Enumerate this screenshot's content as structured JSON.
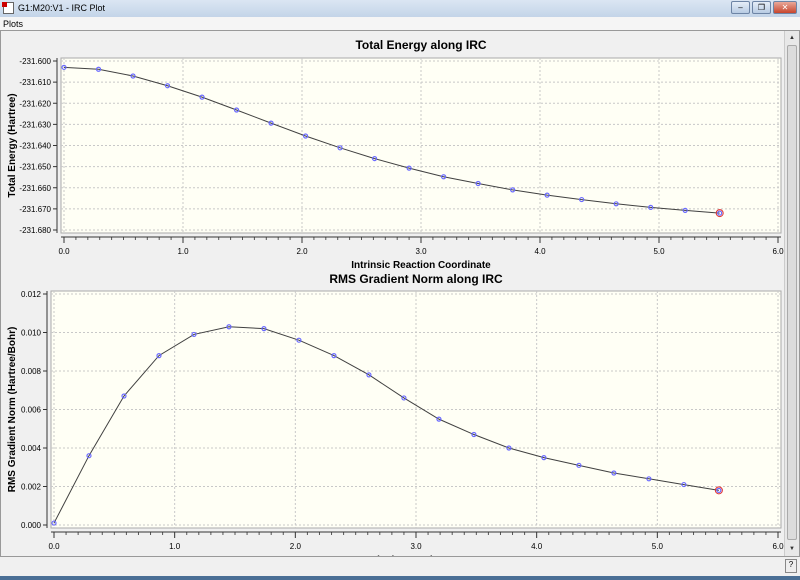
{
  "window": {
    "title": "G1:M20:V1 - IRC Plot",
    "minimize": "–",
    "restore": "❐",
    "close": "✕"
  },
  "menu": {
    "plots": "Plots"
  },
  "statusbar": {
    "icon": "hint-icon"
  },
  "chart_data": [
    {
      "type": "line",
      "title": "Total Energy along IRC",
      "xlabel": "Intrinsic Reaction Coordinate",
      "ylabel": "Total Energy (Hartree)",
      "xlim": [
        0,
        6
      ],
      "ylim": [
        -231.68,
        -231.6
      ],
      "xticks": [
        "0.0",
        "1.0",
        "2.0",
        "3.0",
        "4.0",
        "5.0",
        "6.0"
      ],
      "yticks": [
        "-231.600",
        "-231.610",
        "-231.620",
        "-231.630",
        "-231.640",
        "-231.650",
        "-231.660",
        "-231.670",
        "-231.680"
      ],
      "x": [
        0,
        0.29,
        0.58,
        0.87,
        1.16,
        1.45,
        1.74,
        2.03,
        2.32,
        2.61,
        2.9,
        3.19,
        3.48,
        3.77,
        4.06,
        4.35,
        4.64,
        4.93,
        5.22,
        5.51
      ],
      "y": [
        -231.603,
        -231.6039,
        -231.6071,
        -231.6117,
        -231.6171,
        -231.6232,
        -231.6294,
        -231.6355,
        -231.6411,
        -231.6462,
        -231.6507,
        -231.6548,
        -231.658,
        -231.661,
        -231.6635,
        -231.6656,
        -231.6676,
        -231.6693,
        -231.6707,
        -231.672
      ],
      "grid": true
    },
    {
      "type": "line",
      "title": "RMS Gradient Norm along IRC",
      "xlabel": "Intrinsic Reaction Coor",
      "ylabel": "RMS Gradient Norm (Hartree/Bohr)",
      "xlim": [
        0,
        6
      ],
      "ylim": [
        0,
        0.012
      ],
      "xticks": [
        "0.0",
        "1.0",
        "2.0",
        "3.0",
        "4.0",
        "5.0",
        "6.0"
      ],
      "yticks": [
        "0.000",
        "0.002",
        "0.004",
        "0.006",
        "0.008",
        "0.010",
        "0.012"
      ],
      "x": [
        0,
        0.29,
        0.58,
        0.87,
        1.16,
        1.45,
        1.74,
        2.03,
        2.32,
        2.61,
        2.9,
        3.19,
        3.48,
        3.77,
        4.06,
        4.35,
        4.64,
        4.93,
        5.22,
        5.51
      ],
      "y": [
        0.0001,
        0.0036,
        0.0067,
        0.0088,
        0.0099,
        0.0103,
        0.0102,
        0.0096,
        0.0088,
        0.0078,
        0.0066,
        0.0055,
        0.0047,
        0.004,
        0.0035,
        0.0031,
        0.0027,
        0.0024,
        0.0021,
        0.0018
      ],
      "grid": true
    }
  ],
  "colors": {
    "plot_bg": "#fffff5",
    "point": "#6a6aff",
    "current_point": "#e03030",
    "line": "#404040",
    "grid": "#c8c8c8"
  }
}
